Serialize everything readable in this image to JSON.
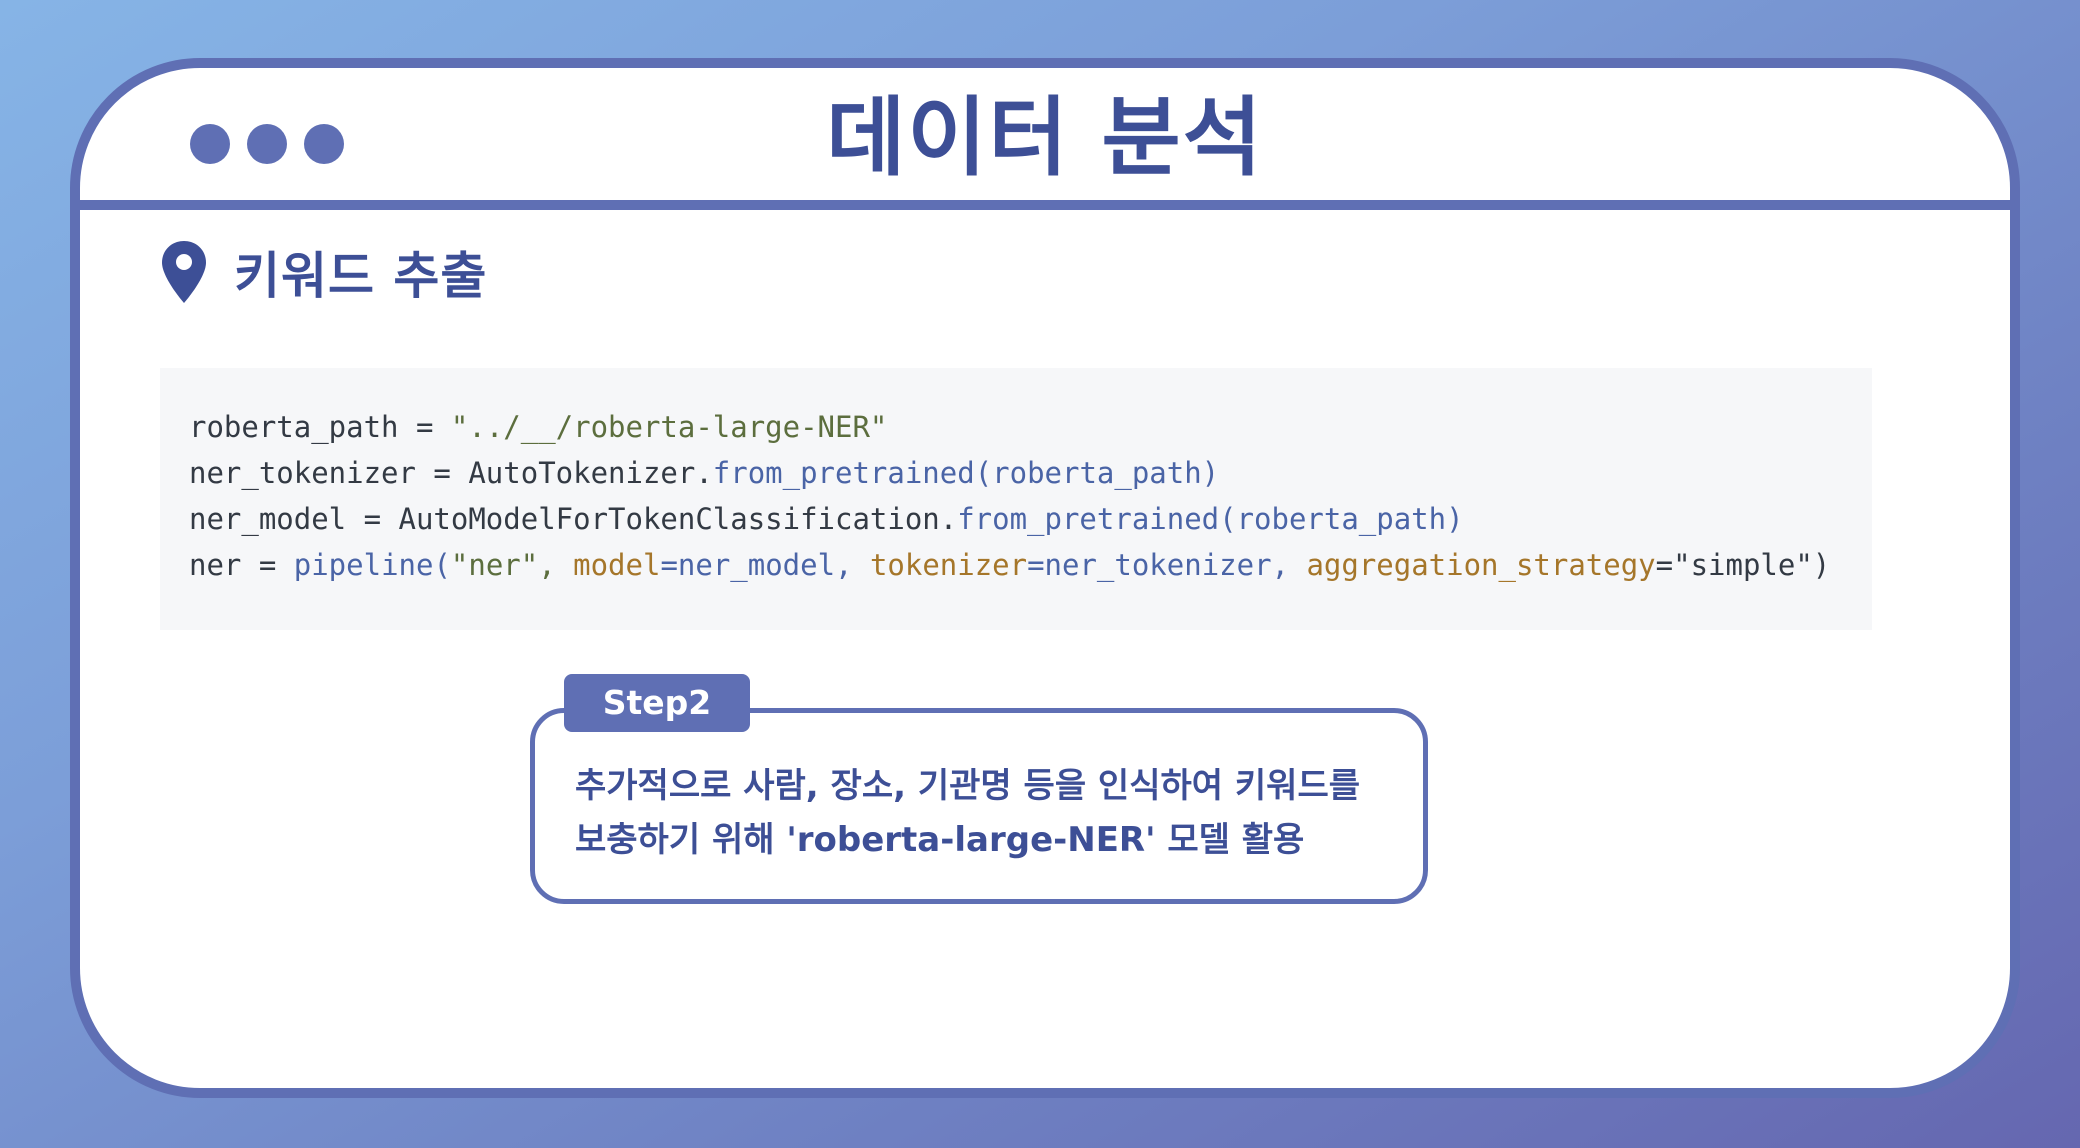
{
  "window": {
    "title": "데이터 분석"
  },
  "section": {
    "icon": "map-pin-icon",
    "title": "키워드 추출"
  },
  "code": {
    "line1": {
      "a": "roberta_path = ",
      "b": "\"../__/roberta-large-NER\""
    },
    "line2": {
      "a": "ner_tokenizer = AutoTokenizer.",
      "b": "from_pretrained(roberta_path)"
    },
    "line3": {
      "a": "ner_model = AutoModelForTokenClassification.",
      "b": "from_pretrained(roberta_path)"
    },
    "line4": {
      "a": "ner = ",
      "b": "pipeline(",
      "c": "\"ner\", ",
      "d": "model",
      "e": "=ner_model, ",
      "f": "tokenizer",
      "g": "=ner_tokenizer, ",
      "h": "aggregation_strategy",
      "i": "=\"simple\")"
    }
  },
  "step": {
    "label": "Step2",
    "line1": "추가적으로 사람, 장소, 기관명 등을 인식하여 키워드를",
    "line2": "보충하기 위해 'roberta-large-NER' 모델 활용"
  },
  "colors": {
    "accent": "#5f6fb4",
    "title": "#3d4f96",
    "code_bg": "#f6f7f9",
    "code_string": "#5c6e3e",
    "code_function": "#4a64a6",
    "code_keyword": "#a5762a"
  }
}
